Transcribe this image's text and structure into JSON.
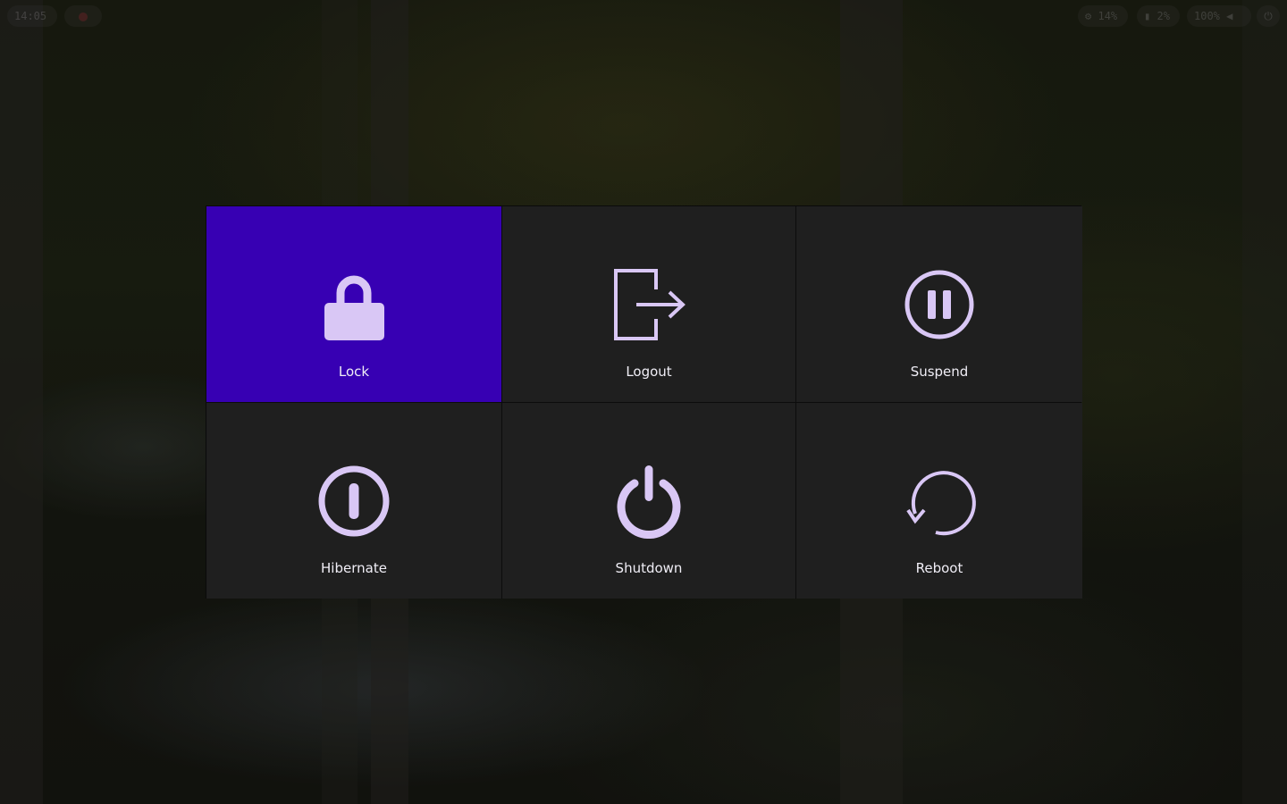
{
  "topbar": {
    "clock": "14:05",
    "cpu": "14%",
    "memory": "2%",
    "volume": "100%"
  },
  "power_menu": {
    "accent_color": "#3700b3",
    "tile_color": "#1f1f1f",
    "icon_color": "#d9c7f5",
    "items": [
      {
        "label": "Lock",
        "icon": "lock-icon",
        "selected": true
      },
      {
        "label": "Logout",
        "icon": "logout-icon",
        "selected": false
      },
      {
        "label": "Suspend",
        "icon": "pause-circle-icon",
        "selected": false
      },
      {
        "label": "Hibernate",
        "icon": "hibernate-icon",
        "selected": false
      },
      {
        "label": "Shutdown",
        "icon": "power-icon",
        "selected": false
      },
      {
        "label": "Reboot",
        "icon": "reboot-icon",
        "selected": false
      }
    ]
  }
}
